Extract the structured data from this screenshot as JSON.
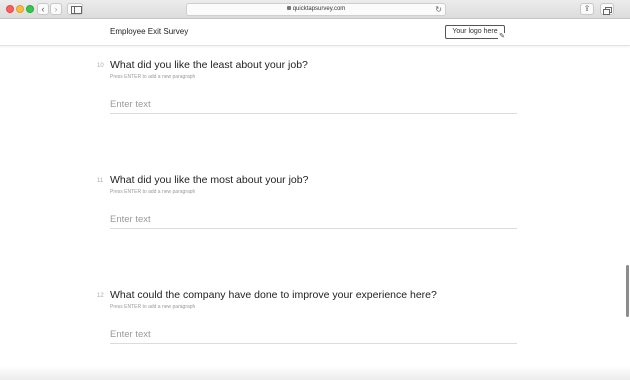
{
  "browser": {
    "url": "quicktapsurvey.com",
    "back_glyph": "‹",
    "forward_glyph": "›",
    "reload_glyph": "↻",
    "share_glyph": "⇪"
  },
  "header": {
    "title": "Employee Exit Survey",
    "logo_placeholder": "Your logo here",
    "logo_edit_glyph": "✎"
  },
  "questions": [
    {
      "number": "10",
      "text": "What did you like the least about your job?",
      "hint": "Press ENTER to add a new paragraph",
      "placeholder": "Enter text"
    },
    {
      "number": "11",
      "text": "What did you like the most about your job?",
      "hint": "Press ENTER to add a new paragraph",
      "placeholder": "Enter text"
    },
    {
      "number": "12",
      "text": "What could the company have done to improve your experience here?",
      "hint": "Press ENTER to add a new paragraph",
      "placeholder": "Enter text"
    }
  ]
}
